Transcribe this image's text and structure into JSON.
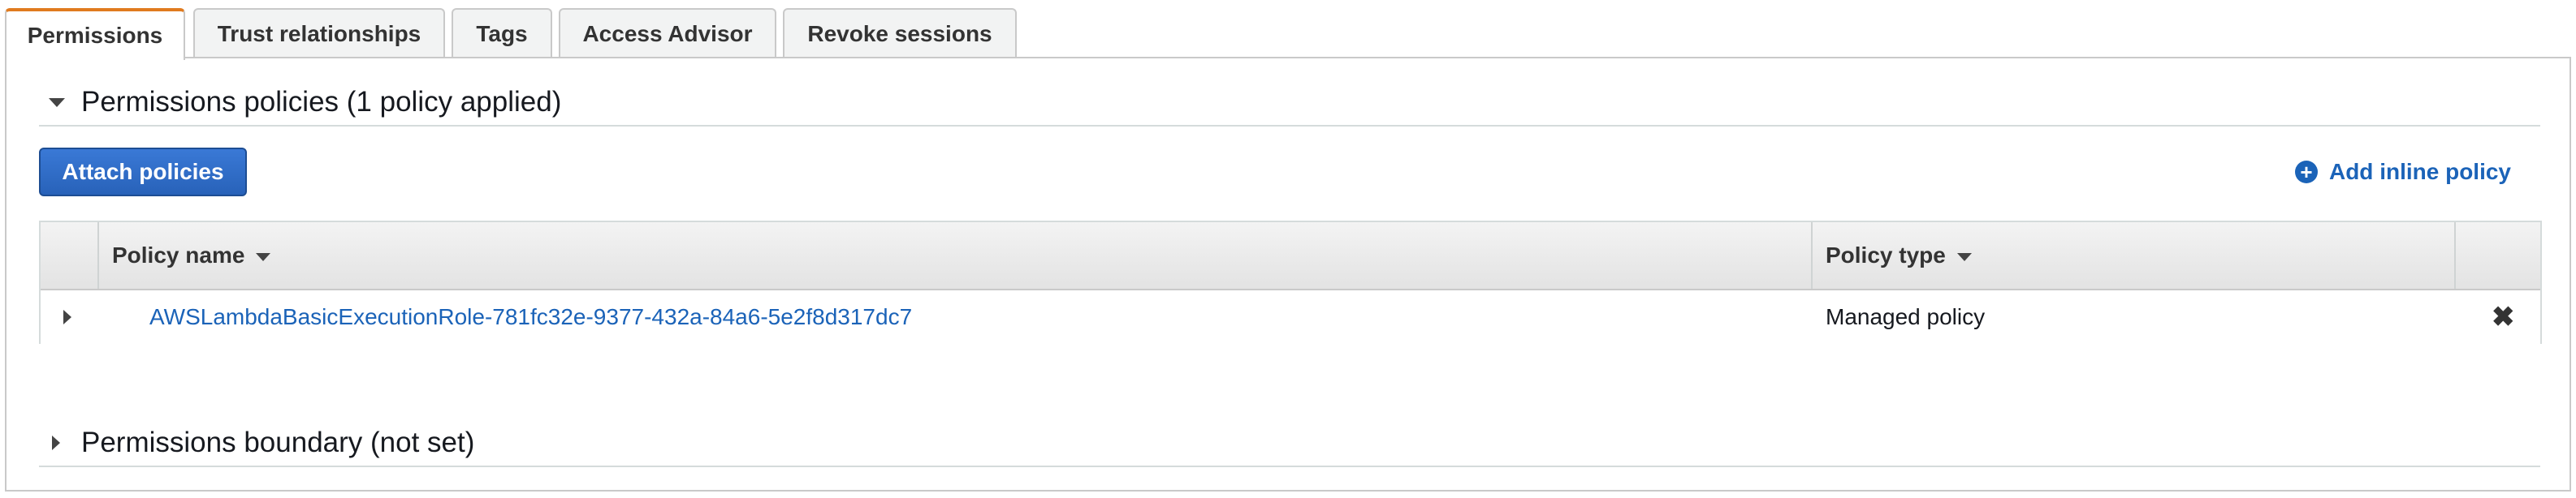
{
  "tabs": [
    {
      "label": "Permissions",
      "active": true
    },
    {
      "label": "Trust relationships",
      "active": false
    },
    {
      "label": "Tags",
      "active": false
    },
    {
      "label": "Access Advisor",
      "active": false
    },
    {
      "label": "Revoke sessions",
      "active": false
    }
  ],
  "permissions_section": {
    "title": "Permissions policies (1 policy applied)",
    "attach_button": "Attach policies",
    "add_inline": "Add inline policy"
  },
  "table": {
    "columns": [
      "Policy name",
      "Policy type"
    ],
    "rows": [
      {
        "policy_name": "AWSLambdaBasicExecutionRole-781fc32e-9377-432a-84a6-5e2f8d317dc7",
        "policy_type": "Managed policy"
      }
    ]
  },
  "boundary_section": {
    "title": "Permissions boundary (not set)"
  },
  "colors": {
    "accent_tab": "#e07b1f",
    "primary_button": "#2862b9",
    "link": "#1b63b8"
  },
  "icons": {
    "expand_open": "caret-down-icon",
    "expand_closed": "caret-right-icon",
    "add": "plus-circle-icon",
    "remove": "close-icon",
    "sort": "sort-caret-icon"
  }
}
